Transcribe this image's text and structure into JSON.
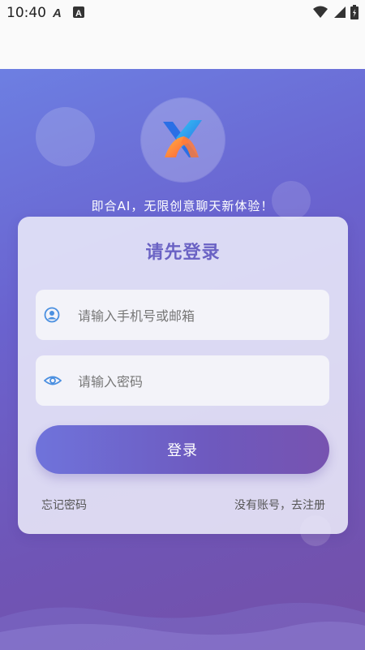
{
  "status_bar": {
    "time": "10:40"
  },
  "slogan": "即合AI，无限创意聊天新体验！",
  "login_card": {
    "title": "请先登录",
    "account_placeholder": "请输入手机号或邮箱",
    "password_placeholder": "请输入密码",
    "login_button": "登录",
    "forgot_password": "忘记密码",
    "register_link": "没有账号，去注册"
  },
  "colors": {
    "accent": "#6a62c4",
    "icon_blue": "#4a8fe0",
    "gradient_start": "#6d7fe2",
    "gradient_end": "#7450a8"
  },
  "icons": {
    "account": "user-circle-icon",
    "password": "eye-icon",
    "logo": "x-logo-icon"
  }
}
